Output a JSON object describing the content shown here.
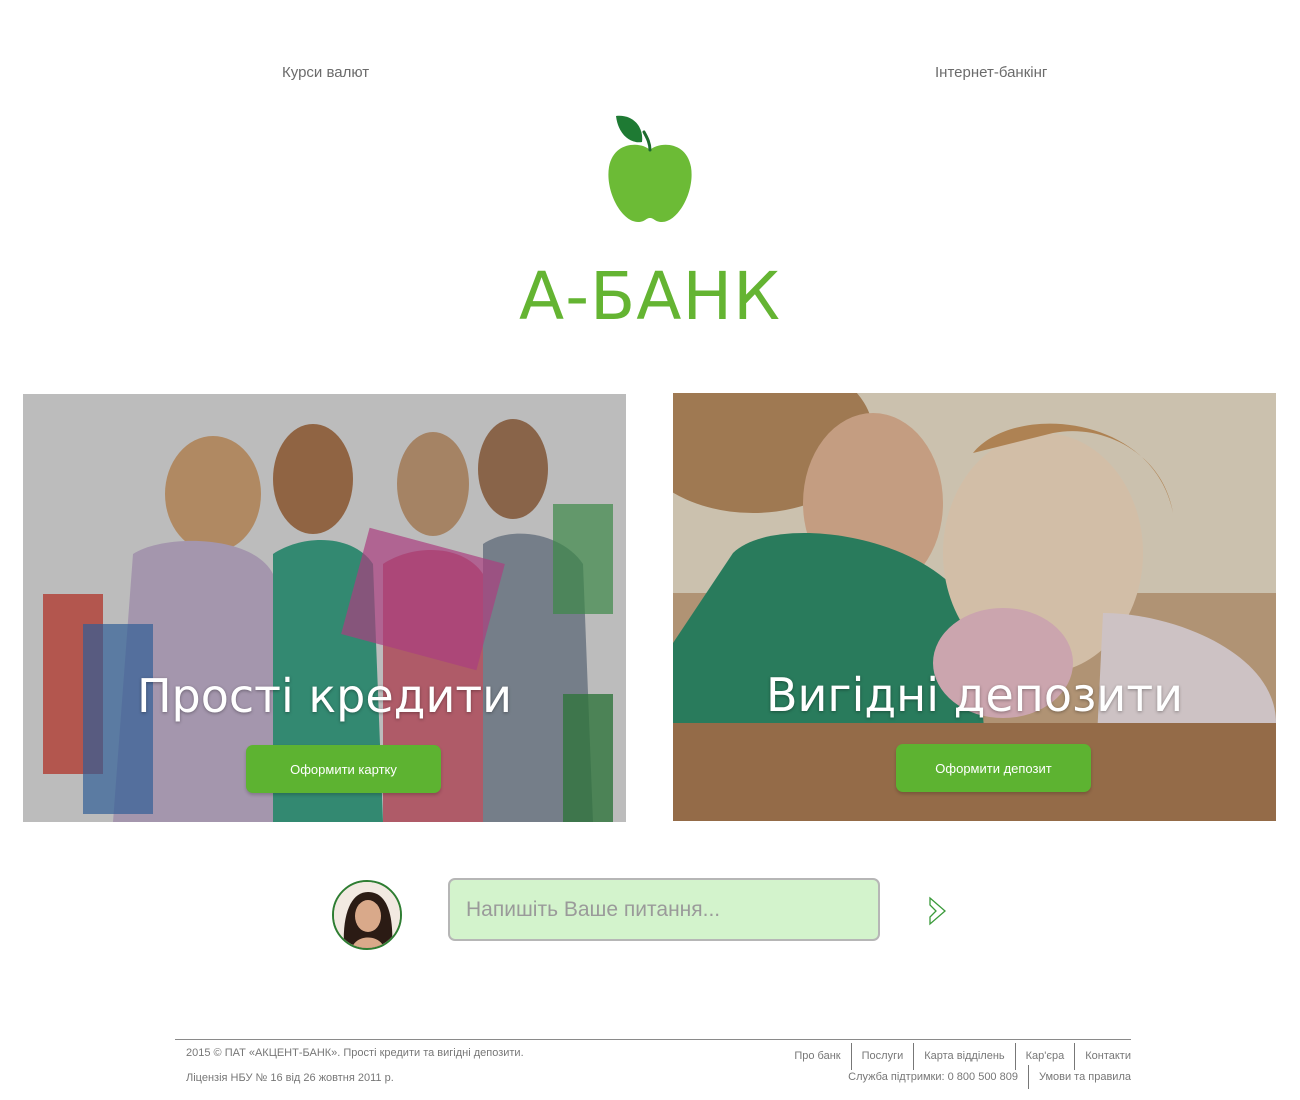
{
  "header": {
    "rates_link": "Курси валют",
    "ibank_link": "Інтернет-банкінг"
  },
  "brand": {
    "logo_icon": "green-apple-icon",
    "name": "А-БАНК",
    "color": "#64b432"
  },
  "promos": [
    {
      "title": "Прості кредити",
      "button": "Оформити картку",
      "image": "women-shopping-bags-photo"
    },
    {
      "title": "Вигідні депозити",
      "button": "Оформити депозит",
      "image": "mother-daughter-piggy-bank-photo"
    }
  ],
  "chat": {
    "avatar": "support-agent-avatar",
    "placeholder": "Напишіть Ваше питання...",
    "value": "",
    "send_icon": "send-arrow-icon"
  },
  "footer": {
    "copyright": "2015 © ПАТ «АКЦЕНТ-БАНК». Прості кредити та вигідні депозити.",
    "license": "Ліцензія НБУ № 16 від 26 жовтня 2011 р.",
    "nav": [
      "Про банк",
      "Послуги",
      "Карта відділень",
      "Кар'єра",
      "Контакти"
    ],
    "support": "Служба підтримки: 0 800 500 809",
    "terms": "Умови та правила"
  },
  "colors": {
    "accent": "#5db331",
    "chat_bg": "#d3f3cc"
  }
}
